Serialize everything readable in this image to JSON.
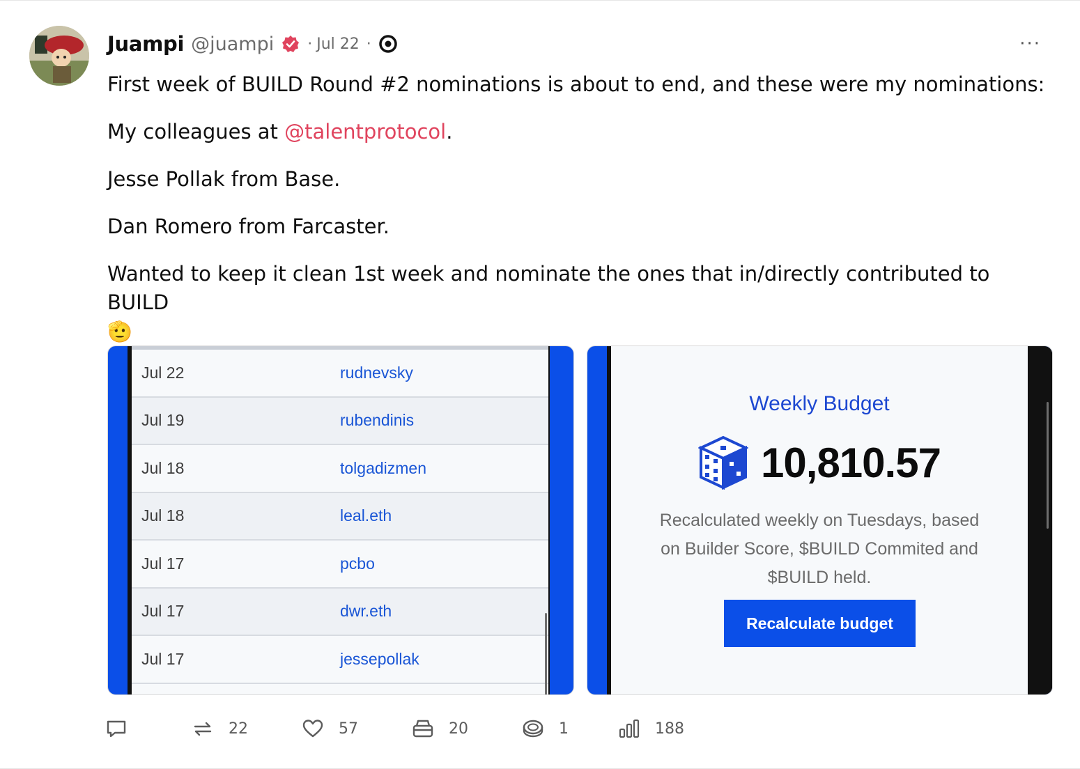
{
  "post": {
    "author": {
      "display_name": "Juampi",
      "handle": "@juampi",
      "verified": true
    },
    "date": "Jul 22",
    "separator": "·",
    "more_label": "···",
    "paragraphs": [
      "First week of BUILD Round #2 nominations is about to end, and these were my nominations:",
      "Jesse Pollak from Base.",
      "Dan Romero from Farcaster.",
      "Wanted to keep it clean 1st week and nominate the ones that in/directly contributed to BUILD"
    ],
    "colleagues_prefix": "My colleagues at ",
    "colleagues_mention": "@talentprotocol",
    "colleagues_suffix": ".",
    "emoji": "🫡"
  },
  "media": {
    "left": {
      "rows": [
        {
          "date": "Jul 22",
          "user": "rudnevsky"
        },
        {
          "date": "Jul 19",
          "user": "rubendinis"
        },
        {
          "date": "Jul 18",
          "user": "tolgadizmen"
        },
        {
          "date": "Jul 18",
          "user": "leal.eth"
        },
        {
          "date": "Jul 17",
          "user": "pcbo"
        },
        {
          "date": "Jul 17",
          "user": "dwr.eth"
        },
        {
          "date": "Jul 17",
          "user": "jessepollak"
        }
      ]
    },
    "right": {
      "title": "Weekly Budget",
      "amount": "10,810.57",
      "description": "Recalculated weekly on Tuesdays, based on Builder Score, $BUILD Commited and $BUILD held.",
      "button_label": "Recalculate budget"
    }
  },
  "actions": {
    "reply": {
      "icon": "comment-icon"
    },
    "recast": {
      "icon": "recast-icon",
      "count": "22"
    },
    "like": {
      "icon": "heart-icon",
      "count": "57"
    },
    "save": {
      "icon": "bookmark-icon",
      "count": "20"
    },
    "tip": {
      "icon": "coin-icon",
      "count": "1"
    },
    "views": {
      "icon": "bar-chart-icon",
      "count": "188"
    }
  },
  "colors": {
    "mention": "#e0445e",
    "verified": "#e0445e",
    "media_accent": "#0b4fe8",
    "link_blue": "#1a56d6"
  }
}
